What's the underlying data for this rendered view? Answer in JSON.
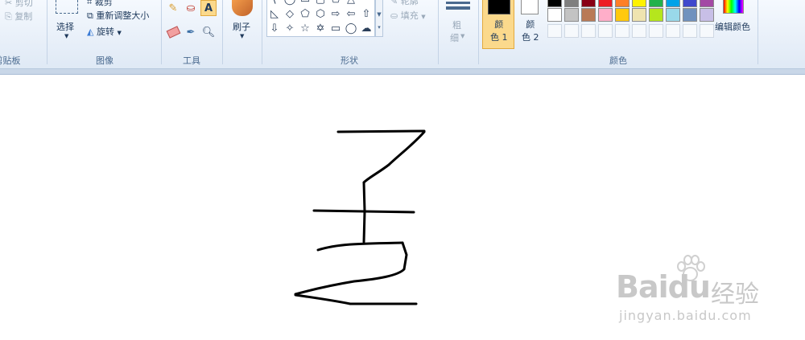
{
  "ribbon": {
    "clipboard": {
      "label": "剪贴板",
      "cut": "剪切",
      "copy": "复制"
    },
    "image": {
      "label": "图像",
      "select": "选择",
      "crop": "裁剪",
      "resize": "重新调整大小",
      "rotate": "旋转"
    },
    "tools": {
      "label": "工具"
    },
    "brush": {
      "label": "刷子"
    },
    "shapes": {
      "label": "形状",
      "outline": "轮廓",
      "fill": "填充"
    },
    "size": {
      "label_1": "粗",
      "label_2": "细"
    },
    "colors": {
      "label": "颜色",
      "color1": "颜\n色 1",
      "color2": "颜\n色 2",
      "color1_value": "#000000",
      "color2_value": "#ffffff",
      "edit": "编辑颜色",
      "palette_row1": [
        "#000000",
        "#7f7f7f",
        "#880015",
        "#ed1c24",
        "#ff7f27",
        "#fff200",
        "#22b14c",
        "#00a2e8",
        "#3f48cc",
        "#a349a4"
      ],
      "palette_row2": [
        "#ffffff",
        "#c3c3c3",
        "#b97a57",
        "#ffaec9",
        "#ffc90e",
        "#efe4b0",
        "#b5e61d",
        "#99d9ea",
        "#7092be",
        "#c8bfe7"
      ]
    }
  },
  "watermark": {
    "brand": "Bai",
    "brand2": "du",
    "service": "经验",
    "url": "jingyan.baidu.com"
  }
}
